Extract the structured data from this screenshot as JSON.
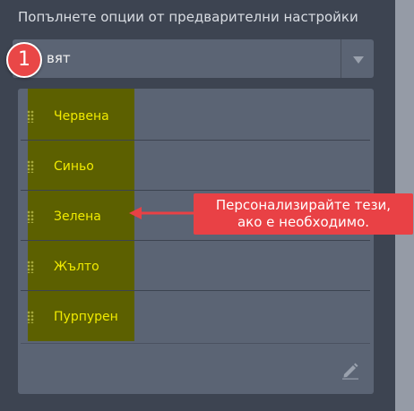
{
  "section": {
    "title": "Попълнете опции от предварителни настройки"
  },
  "dropdown": {
    "value": "вят",
    "arrow_icon": "chevron-down-icon"
  },
  "step_badge": {
    "number": "1"
  },
  "options": [
    {
      "label": "Червена"
    },
    {
      "label": "Синьо"
    },
    {
      "label": "Зелена"
    },
    {
      "label": "Жълто"
    },
    {
      "label": "Пурпурен"
    }
  ],
  "edit_icon": "pencil-icon",
  "callout": {
    "line1": "Персонализирайте тези,",
    "line2": "ако е необходимо."
  },
  "colors": {
    "background": "#3d4451",
    "panel": "#5b6474",
    "highlight": "#5c6000",
    "highlight_text": "#f0ea00",
    "accent": "#e94145"
  }
}
